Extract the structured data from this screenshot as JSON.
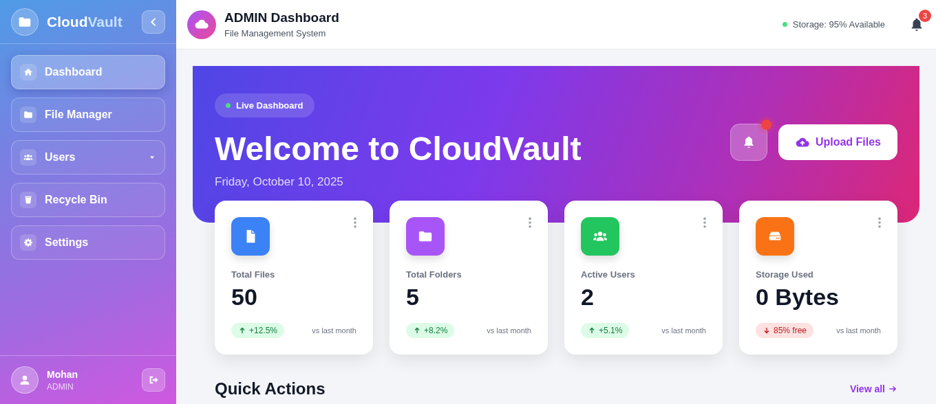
{
  "sidebar": {
    "brand_parts": [
      "Cloud",
      "Vault"
    ],
    "nav_items": [
      {
        "label": "Dashboard",
        "selected": true,
        "has_submenu": false
      },
      {
        "label": "File Manager",
        "selected": false,
        "has_submenu": false
      },
      {
        "label": "Users",
        "selected": false,
        "has_submenu": true
      },
      {
        "label": "Recycle Bin",
        "selected": false,
        "has_submenu": false
      },
      {
        "label": "Settings",
        "selected": false,
        "has_submenu": false
      }
    ],
    "user": {
      "name": "Mohan",
      "role": "ADMIN"
    }
  },
  "header": {
    "title": "ADMIN Dashboard",
    "subtitle": "File Management System",
    "storage_status": "Storage: 95% Available",
    "notification_count": "3"
  },
  "hero": {
    "badge": "Live Dashboard",
    "title": "Welcome to CloudVault",
    "date": "Friday, October 10, 2025",
    "bell_alert": true,
    "upload_button": "Upload Files"
  },
  "stats": [
    {
      "label": "Total Files",
      "value": "50",
      "change": "+12.5%",
      "kind": "up",
      "note": "vs last month",
      "color": "#3b82f6"
    },
    {
      "label": "Total Folders",
      "value": "5",
      "change": "+8.2%",
      "kind": "up",
      "note": "vs last month",
      "color": "#a855f7"
    },
    {
      "label": "Active Users",
      "value": "2",
      "change": "+5.1%",
      "kind": "up",
      "note": "vs last month",
      "color": "#22c55e"
    },
    {
      "label": "Storage Used",
      "value": "0 Bytes",
      "change": "85% free",
      "kind": "down",
      "note": "vs last month",
      "color": "#f97316"
    }
  ],
  "quick_actions": {
    "title": "Quick Actions",
    "link": "View all"
  }
}
